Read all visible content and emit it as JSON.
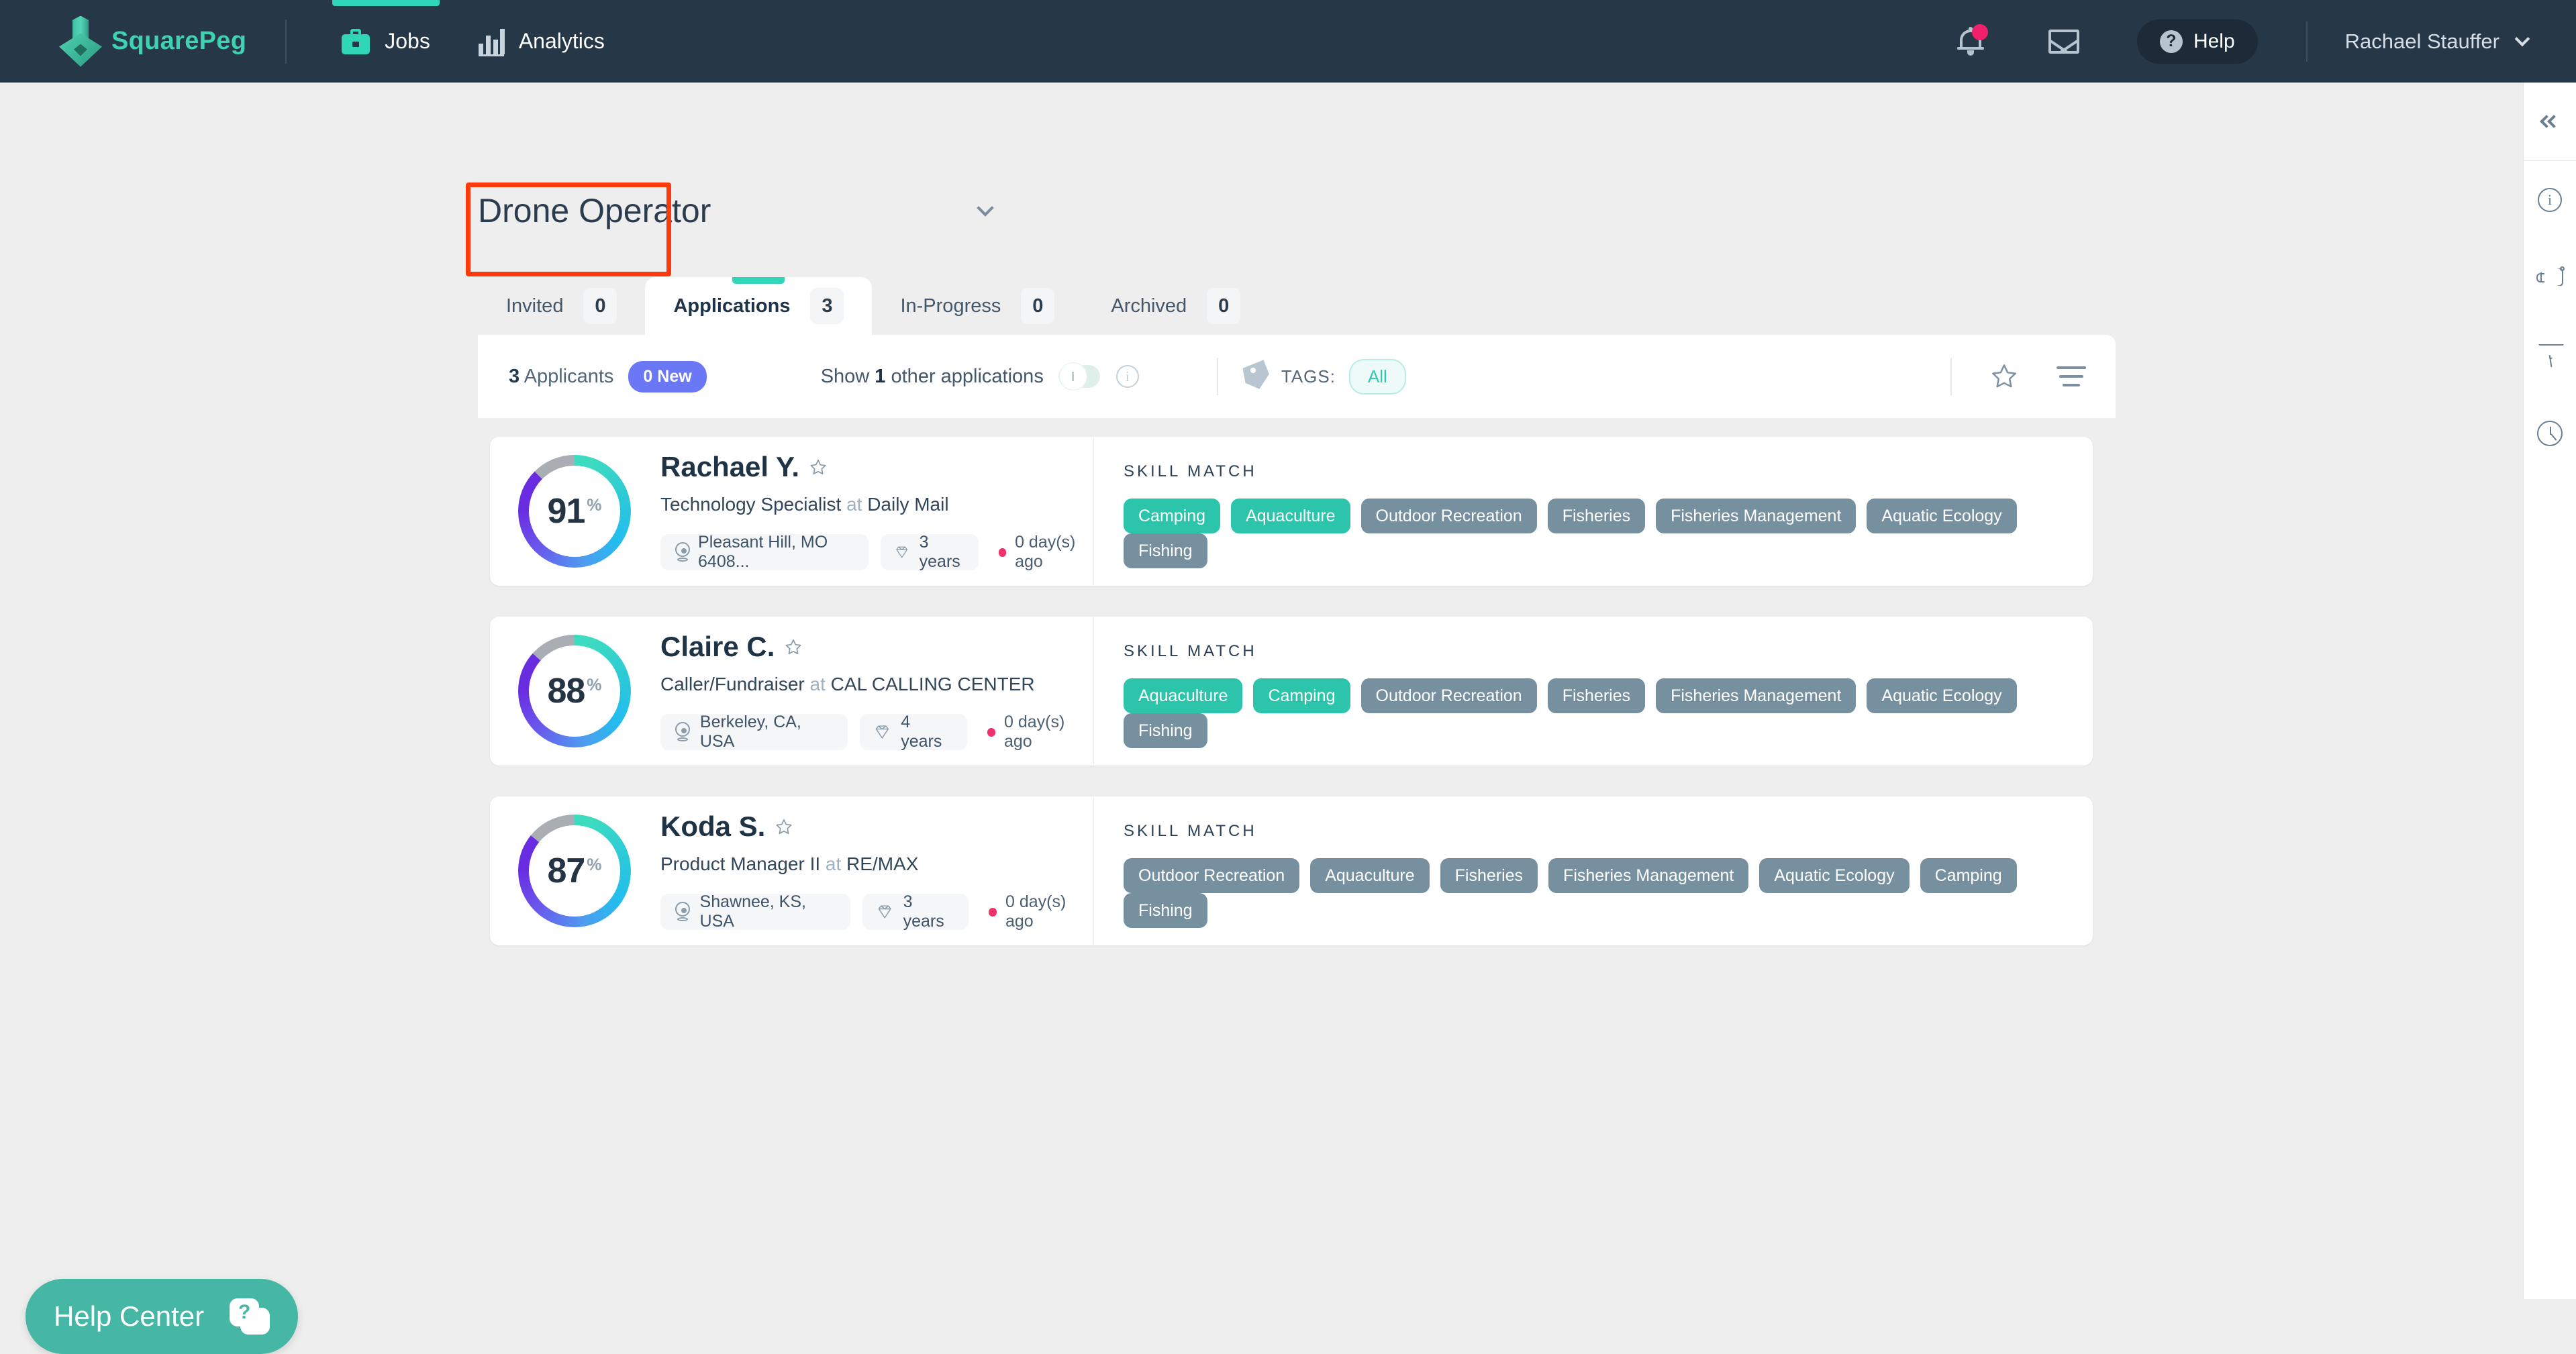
{
  "topnav": {
    "brand_name": "SquarePeg",
    "nav_items": [
      {
        "label": "Jobs",
        "icon": "briefcase-icon",
        "active": true
      },
      {
        "label": "Analytics",
        "icon": "bar-chart-icon",
        "active": false
      }
    ],
    "help_label": "Help",
    "user_name": "Rachael Stauffer",
    "notification_badge": ""
  },
  "page": {
    "job_title": "Drone Operator",
    "tabs": [
      {
        "label": "Invited",
        "count": "0"
      },
      {
        "label": "Applications",
        "count": "3"
      },
      {
        "label": "In-Progress",
        "count": "0"
      },
      {
        "label": "Archived",
        "count": "0"
      }
    ],
    "toolbar": {
      "applicant_count": "3",
      "applicants_word": "Applicants",
      "new_badge": "0 New",
      "show_other_prefix": "Show",
      "show_other_count": "1",
      "show_other_suffix": "other applications",
      "tags_label": "TAGS:",
      "tag_all": "All"
    },
    "skill_match_header": "SKILL MATCH",
    "candidates": [
      {
        "score": "91",
        "pct": "%",
        "name": "Rachael Y.",
        "role": "Technology Specialist",
        "at": "at",
        "company": "Daily Mail",
        "location": "Pleasant Hill, MO 6408...",
        "experience": "3 years",
        "ago": "0 day(s) ago",
        "skills": [
          {
            "label": "Camping",
            "match": true
          },
          {
            "label": "Aquaculture",
            "match": true
          },
          {
            "label": "Outdoor Recreation",
            "match": false
          },
          {
            "label": "Fisheries",
            "match": false
          },
          {
            "label": "Fisheries Management",
            "match": false
          },
          {
            "label": "Aquatic Ecology",
            "match": false
          },
          {
            "label": "Fishing",
            "match": false
          }
        ]
      },
      {
        "score": "88",
        "pct": "%",
        "name": "Claire C.",
        "role": "Caller/Fundraiser",
        "at": "at",
        "company": "CAL CALLING CENTER",
        "location": "Berkeley, CA, USA",
        "experience": "4 years",
        "ago": "0 day(s) ago",
        "skills": [
          {
            "label": "Aquaculture",
            "match": true
          },
          {
            "label": "Camping",
            "match": true
          },
          {
            "label": "Outdoor Recreation",
            "match": false
          },
          {
            "label": "Fisheries",
            "match": false
          },
          {
            "label": "Fisheries Management",
            "match": false
          },
          {
            "label": "Aquatic Ecology",
            "match": false
          },
          {
            "label": "Fishing",
            "match": false
          }
        ]
      },
      {
        "score": "87",
        "pct": "%",
        "name": "Koda S.",
        "role": "Product Manager II",
        "at": "at",
        "company": "RE/MAX",
        "location": "Shawnee, KS, USA",
        "experience": "3 years",
        "ago": "0 day(s) ago",
        "skills": [
          {
            "label": "Outdoor Recreation",
            "match": false
          },
          {
            "label": "Aquaculture",
            "match": false
          },
          {
            "label": "Fisheries",
            "match": false
          },
          {
            "label": "Fisheries Management",
            "match": false
          },
          {
            "label": "Aquatic Ecology",
            "match": false
          },
          {
            "label": "Camping",
            "match": false
          },
          {
            "label": "Fishing",
            "match": false
          }
        ]
      }
    ]
  },
  "right_rail": {
    "icons": [
      "collapse-double-chevron-icon",
      "info-circle-icon",
      "megaphone-icon",
      "funnel-icon",
      "clock-icon"
    ]
  },
  "help_center": {
    "label": "Help Center",
    "icon_glyph": "?"
  },
  "colors": {
    "nav_bg": "#263747",
    "accent_teal": "#2fd6b8",
    "match_tag": "#2cc5ab",
    "nomatch_tag": "#76909f",
    "new_badge": "#6b78f5",
    "highlight_box": "#f93b0d",
    "ago_dot": "#f0316c",
    "help_fab": "#45b7a4"
  }
}
